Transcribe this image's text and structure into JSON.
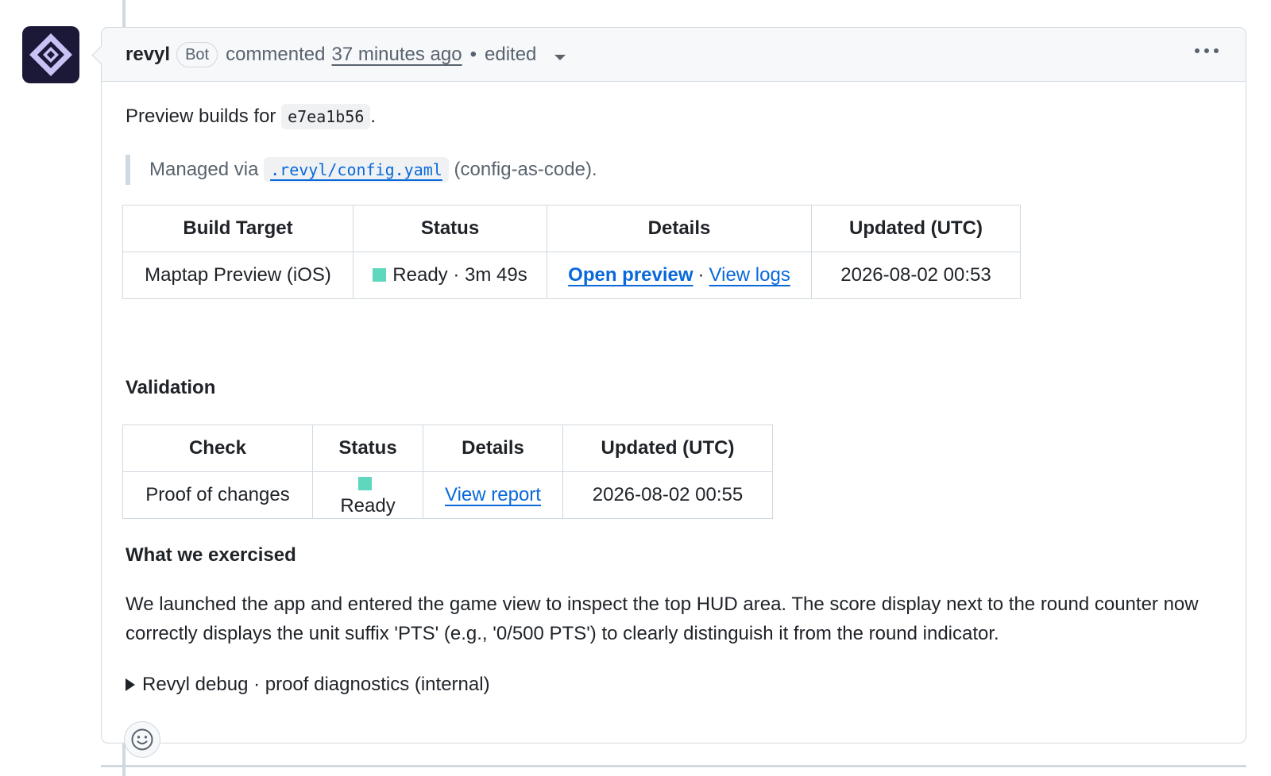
{
  "comment": {
    "author": "revyl",
    "badge": "Bot",
    "action": "commented",
    "timestamp": "37 minutes ago",
    "separator": "•",
    "edited_label": "edited"
  },
  "body": {
    "preview_prefix": "Preview builds for",
    "commit_sha": "e7ea1b56",
    "preview_suffix": ".",
    "managed_prefix": "Managed via",
    "config_path": ".revyl/config.yaml",
    "managed_suffix": "(config-as-code).",
    "build_table": {
      "headers": [
        "Build Target",
        "Status",
        "Details",
        "Updated (UTC)"
      ],
      "rows": [
        {
          "target": "Maptap Preview (iOS)",
          "status": "Ready · 3m 49s",
          "status_color": "#5fd6be",
          "details_link1": "Open preview",
          "details_sep": "·",
          "details_link2": "View logs",
          "updated": "2026-08-02 00:53"
        }
      ]
    },
    "validation_heading": "Validation",
    "validation_table": {
      "headers": [
        "Check",
        "Status",
        "Details",
        "Updated (UTC)"
      ],
      "rows": [
        {
          "check": "Proof of changes",
          "status": "Ready",
          "status_color": "#5fd6be",
          "details_link": "View report",
          "updated": "2026-08-02 00:55"
        }
      ]
    },
    "exercised_heading": "What we exercised",
    "exercised_text": "We launched the app and entered the game view to inspect the top HUD area. The score display next to the round counter now correctly displays the unit suffix 'PTS' (e.g., '0/500 PTS') to clearly distinguish it from the round indicator.",
    "debug_summary": "Revyl debug · proof diagnostics (internal)"
  },
  "icons": {
    "avatar": "revyl-diamond-logo-icon",
    "menu": "kebab-menu-icon",
    "caret": "caret-down-icon",
    "disclosure": "disclosure-triangle-icon",
    "reaction": "smiley-icon"
  },
  "colors": {
    "link": "#0969da",
    "status_ready": "#5fd6be",
    "avatar_bg": "#1b1838",
    "avatar_logo": "#c9c2f5"
  }
}
